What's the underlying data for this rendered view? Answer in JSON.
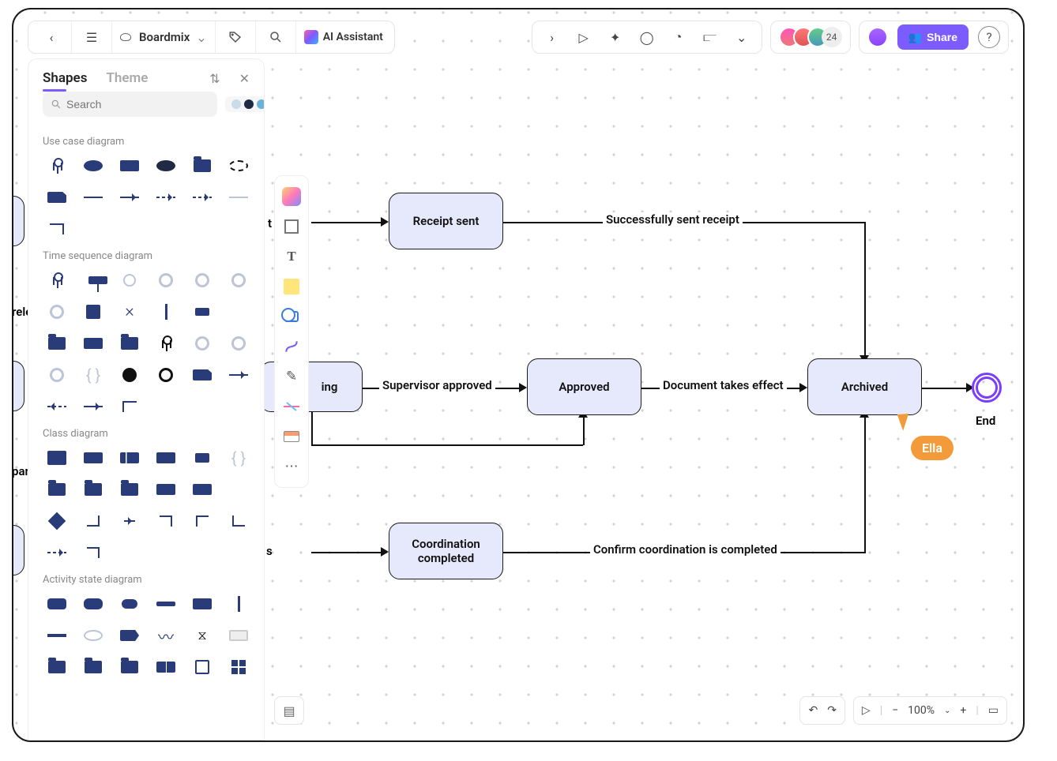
{
  "app": {
    "title": "Boardmix"
  },
  "ai": {
    "label": "AI Assistant"
  },
  "toolbar_top": {
    "share": "Share",
    "help": "?",
    "avatar_extra": "24"
  },
  "panel": {
    "tabs": {
      "shapes": "Shapes",
      "theme": "Theme"
    },
    "search_placeholder": "Search",
    "categories": {
      "use_case": "Use case diagram",
      "time_seq": "Time sequence diagram",
      "class": "Class diagram",
      "activity": "Activity state diagram"
    }
  },
  "canvas": {
    "nodes": {
      "receipt_sent": "Receipt sent",
      "approved": "Approved",
      "archived": "Archived",
      "coord_completed": "Coordination completed",
      "end": "End"
    },
    "edges": {
      "success_receipt": "Successfully sent receipt",
      "supervisor_approved": "Supervisor approved",
      "doc_effect": "Document takes effect",
      "confirm_coord": "Confirm coordination is completed"
    },
    "partial": {
      "ing": "ing",
      "t": "t",
      "s": "s",
      "rele": "rele",
      "par": "par"
    },
    "collaborator": "Ella"
  },
  "bottombar": {
    "zoom": "100%"
  }
}
